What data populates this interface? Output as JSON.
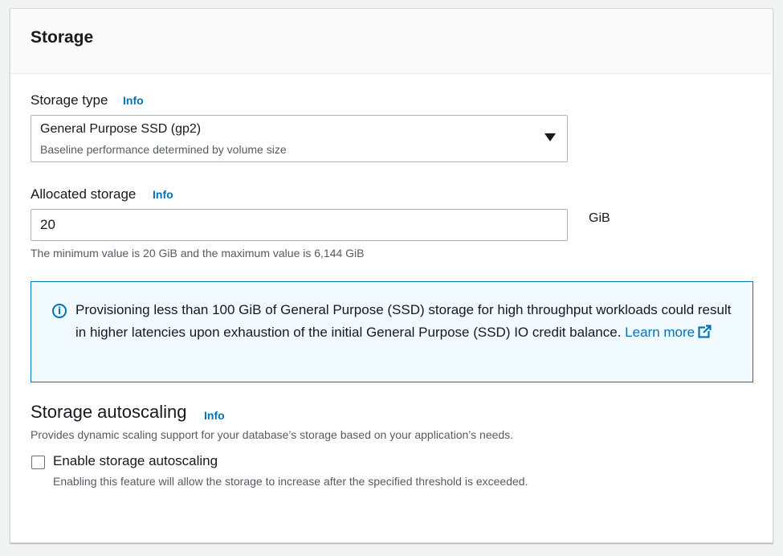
{
  "panel": {
    "title": "Storage"
  },
  "storage_type": {
    "label": "Storage type",
    "info": "Info",
    "selected_value": "General Purpose SSD (gp2)",
    "selected_description": "Baseline performance determined by volume size"
  },
  "allocated_storage": {
    "label": "Allocated storage",
    "info": "Info",
    "value": "20",
    "unit": "GiB",
    "constraint": "The minimum value is 20 GiB and the maximum value is 6,144 GiB"
  },
  "alert": {
    "text": "Provisioning less than 100 GiB of General Purpose (SSD) storage for high throughput workloads could result in higher latencies upon exhaustion of the initial General Purpose (SSD) IO credit balance.",
    "link_label": "Learn more",
    "icon": "info-circle-icon",
    "link_icon": "external-link-icon"
  },
  "autoscaling": {
    "title": "Storage autoscaling",
    "info": "Info",
    "description": "Provides dynamic scaling support for your database’s storage based on your application’s needs.",
    "checkbox_label": "Enable storage autoscaling",
    "checkbox_checked": false,
    "checkbox_description": "Enabling this feature will allow the storage to increase after the specified threshold is exceeded."
  },
  "colors": {
    "link": "#0073bb",
    "alert_bg": "#f1faff",
    "text": "#16191f",
    "secondary_text": "#545b64"
  }
}
